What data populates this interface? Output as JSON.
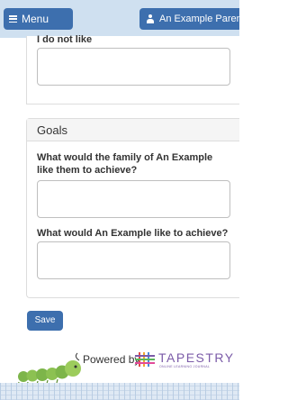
{
  "header": {
    "menu_label": "Menu",
    "user_label": "An Example Parent"
  },
  "form": {
    "dislikes": {
      "label": "I do not like",
      "value": ""
    },
    "goals": {
      "title": "Goals",
      "family_question": "What would the family of An Example like them to achieve?",
      "family_value": "",
      "child_question": "What would An Example like to achieve?",
      "child_value": ""
    },
    "save_label": "Save"
  },
  "footer": {
    "powered_by": "Powered by",
    "brand_name": "TAPESTRY",
    "brand_tagline": "ONLINE LEARNING JOURNAL"
  },
  "colors": {
    "primary": "#3d6fae",
    "topbar": "#cfe0f0",
    "brand": "#7b5ba8"
  }
}
